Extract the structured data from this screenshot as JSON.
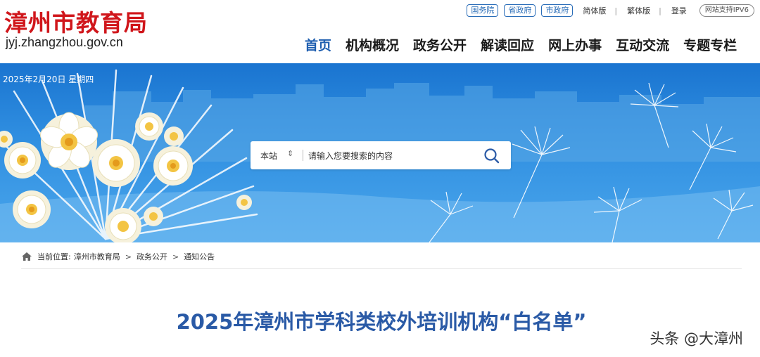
{
  "header": {
    "site_title": "漳州市教育局",
    "domain": "jyj.zhangzhou.gov.cn",
    "gov_links": [
      "国务院",
      "省政府",
      "市政府"
    ],
    "links": [
      "简体版",
      "繁体版",
      "登录"
    ],
    "ipv6": "网站支持IPV6"
  },
  "nav": [
    "首页",
    "机构概况",
    "政务公开",
    "解读回应",
    "网上办事",
    "互动交流",
    "专题专栏"
  ],
  "banner": {
    "date": "2025年2月20日 星期四",
    "search_scope": "本站",
    "search_placeholder": "请输入您要搜索的内容"
  },
  "breadcrumb": {
    "label": "当前位置:",
    "items": [
      "漳州市教育局",
      "政务公开",
      "通知公告"
    ]
  },
  "article": {
    "title": "2025年漳州市学科类校外培训机构“白名单”"
  },
  "watermark": "头条 @大漳州",
  "colors": {
    "brand_red": "#d0161b",
    "nav_active": "#1f5fb0",
    "title_blue": "#2a5aa6"
  }
}
